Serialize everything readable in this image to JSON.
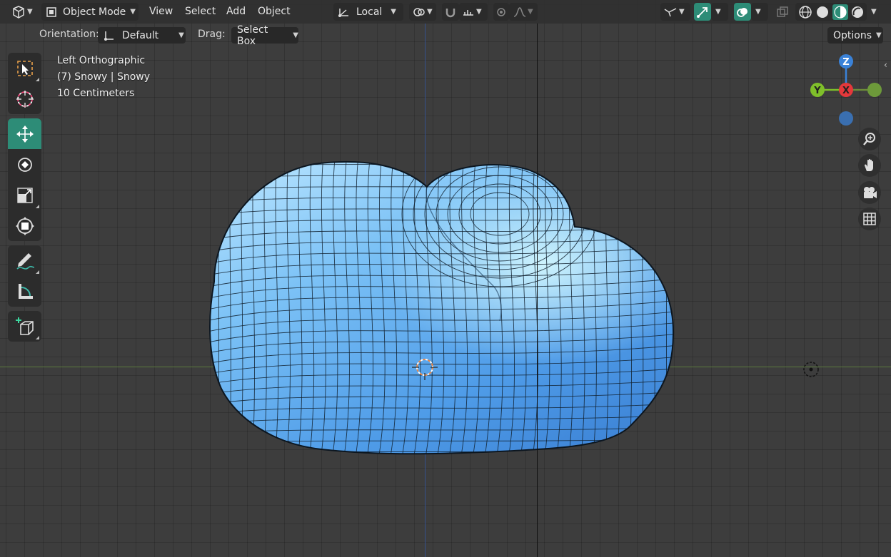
{
  "header": {
    "mode_label": "Object Mode",
    "menus": [
      "View",
      "Select",
      "Add",
      "Object"
    ],
    "transform_orientation": "Local",
    "options_label": "Options"
  },
  "toolbar": {
    "orientation_label": "Orientation:",
    "orientation_value": "Default",
    "drag_label": "Drag:",
    "drag_value": "Select Box"
  },
  "overlay": {
    "view_name": "Left Orthographic",
    "object_info": "(7) Snowy | Snowy",
    "scale": "10 Centimeters"
  },
  "gizmo": {
    "z": "Z",
    "y": "Y",
    "x": "X"
  },
  "tools": [
    "select-box",
    "cursor",
    "move",
    "rotate",
    "scale",
    "transform",
    "annotate",
    "measure",
    "add-cube"
  ],
  "colors": {
    "accent": "#2d8c77",
    "mesh": "#5aa8f0",
    "axis_x": "#e5383b",
    "axis_y": "#7fbf2a",
    "axis_z": "#3a82d8"
  }
}
